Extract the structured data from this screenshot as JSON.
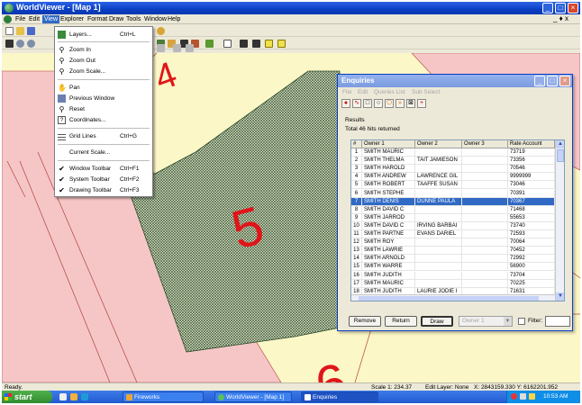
{
  "window": {
    "title": "WorldViewer - [Map 1]"
  },
  "menubar": {
    "items": [
      "File",
      "Edit",
      "View",
      "Explorer",
      "Format",
      "Draw",
      "Tools",
      "Window",
      "Help"
    ],
    "active": "View",
    "mdi_controls": "_ ♦ x"
  },
  "view_menu": {
    "items": [
      {
        "label": "Layers...",
        "shortcut": "Ctrl+L",
        "icon": "layers-icon"
      },
      {
        "label": "Zoom In",
        "shortcut": "",
        "icon": "zoom-in-icon"
      },
      {
        "label": "Zoom Out",
        "shortcut": "",
        "icon": "zoom-out-icon"
      },
      {
        "label": "Zoom Scale...",
        "shortcut": "",
        "icon": "zoom-scale-icon"
      },
      {
        "label": "Pan",
        "shortcut": "",
        "icon": "pan-icon"
      },
      {
        "label": "Previous Window",
        "shortcut": "",
        "icon": "previous-window-icon"
      },
      {
        "label": "Reset",
        "shortcut": "",
        "icon": "reset-icon"
      },
      {
        "label": "Coordinates...",
        "shortcut": "",
        "icon": "coordinates-icon"
      },
      {
        "label": "Grid Lines",
        "shortcut": "Ctrl+G",
        "icon": "grid-lines-icon"
      },
      {
        "label": "Current Scale...",
        "shortcut": "",
        "icon": ""
      },
      {
        "label": "Window Toolbar",
        "shortcut": "Ctrl+F1",
        "icon": "check-icon"
      },
      {
        "label": "System Toolbar",
        "shortcut": "Ctrl+F2",
        "icon": "check-icon"
      },
      {
        "label": "Drawing Toolbar",
        "shortcut": "Ctrl+F3",
        "icon": "check-icon"
      }
    ]
  },
  "map": {
    "labels": [
      "4",
      "5",
      "6"
    ],
    "colors": {
      "background": "#fcf7c6",
      "pink_area": "#f6c6c6",
      "hatched_parcel": "#2b4a2b",
      "label_red": "#e0151a"
    }
  },
  "enquiries": {
    "title": "Enquiries",
    "menu": [
      "File",
      "Edit",
      "Queries List",
      "Sub Select"
    ],
    "results_label": "Results",
    "hits_label": "Total 46 hits returned",
    "columns": [
      "#",
      "Owner 1",
      "Owner 2",
      "Owner 3",
      "Rate Account"
    ],
    "rows": [
      [
        "1",
        "SMITH MAURIC",
        "",
        "",
        "73719"
      ],
      [
        "2",
        "SMITH THELMA",
        "TAIT JAMIESON",
        "",
        "73356"
      ],
      [
        "3",
        "SMITH HAROLD",
        "",
        "",
        "70546"
      ],
      [
        "4",
        "SMITH ANDREW",
        "LAWRENCE GIL",
        "",
        "9999999"
      ],
      [
        "5",
        "SMITH ROBERT",
        "TAAFFE SUSAN",
        "",
        "73046"
      ],
      [
        "6",
        "SMITH STEPHE",
        "",
        "",
        "70391"
      ],
      [
        "7",
        "SMITH DENIS",
        "DUNNE PAULA",
        "",
        "70367"
      ],
      [
        "8",
        "SMITH DAVID C",
        "",
        "",
        "71468"
      ],
      [
        "9",
        "SMITH JARROD",
        "",
        "",
        "55653"
      ],
      [
        "10",
        "SMITH DAVID C",
        "IRVING BARBAI",
        "",
        "73740"
      ],
      [
        "11",
        "SMITH PARTNE",
        "EVANS DARIEL",
        "",
        "72593"
      ],
      [
        "12",
        "SMITH ROY",
        "",
        "",
        "70064"
      ],
      [
        "13",
        "SMITH LAWRIE",
        "",
        "",
        "70452"
      ],
      [
        "14",
        "SMITH ARNOLD",
        "",
        "",
        "72992"
      ],
      [
        "15",
        "SMITH WARRE",
        "",
        "",
        "56900"
      ],
      [
        "16",
        "SMITH JUDITH",
        "",
        "",
        "73704"
      ],
      [
        "17",
        "SMITH MAURIC",
        "",
        "",
        "70225"
      ],
      [
        "18",
        "SMITH JUDITH",
        "LAURIE JODIE I",
        "",
        "71631"
      ]
    ],
    "selected_row": 7,
    "buttons": {
      "remove": "Remove",
      "return": "Return",
      "draw": "Draw"
    },
    "owner_select_value": "Owner 1",
    "filter_label": "Filter:"
  },
  "status": {
    "ready": "Ready.",
    "scale": "Scale 1: 234.37",
    "edit_layer": "Edit Layer: None",
    "coords": "X: 2843159.330 Y: 6162201.952"
  },
  "taskbar": {
    "start": "start",
    "tasks": [
      {
        "label": "Fireworks",
        "active": false
      },
      {
        "label": "WorldViewer - [Map 1]",
        "active": false
      },
      {
        "label": "Enquiries",
        "active": true
      }
    ],
    "clock": "10:53 AM"
  }
}
